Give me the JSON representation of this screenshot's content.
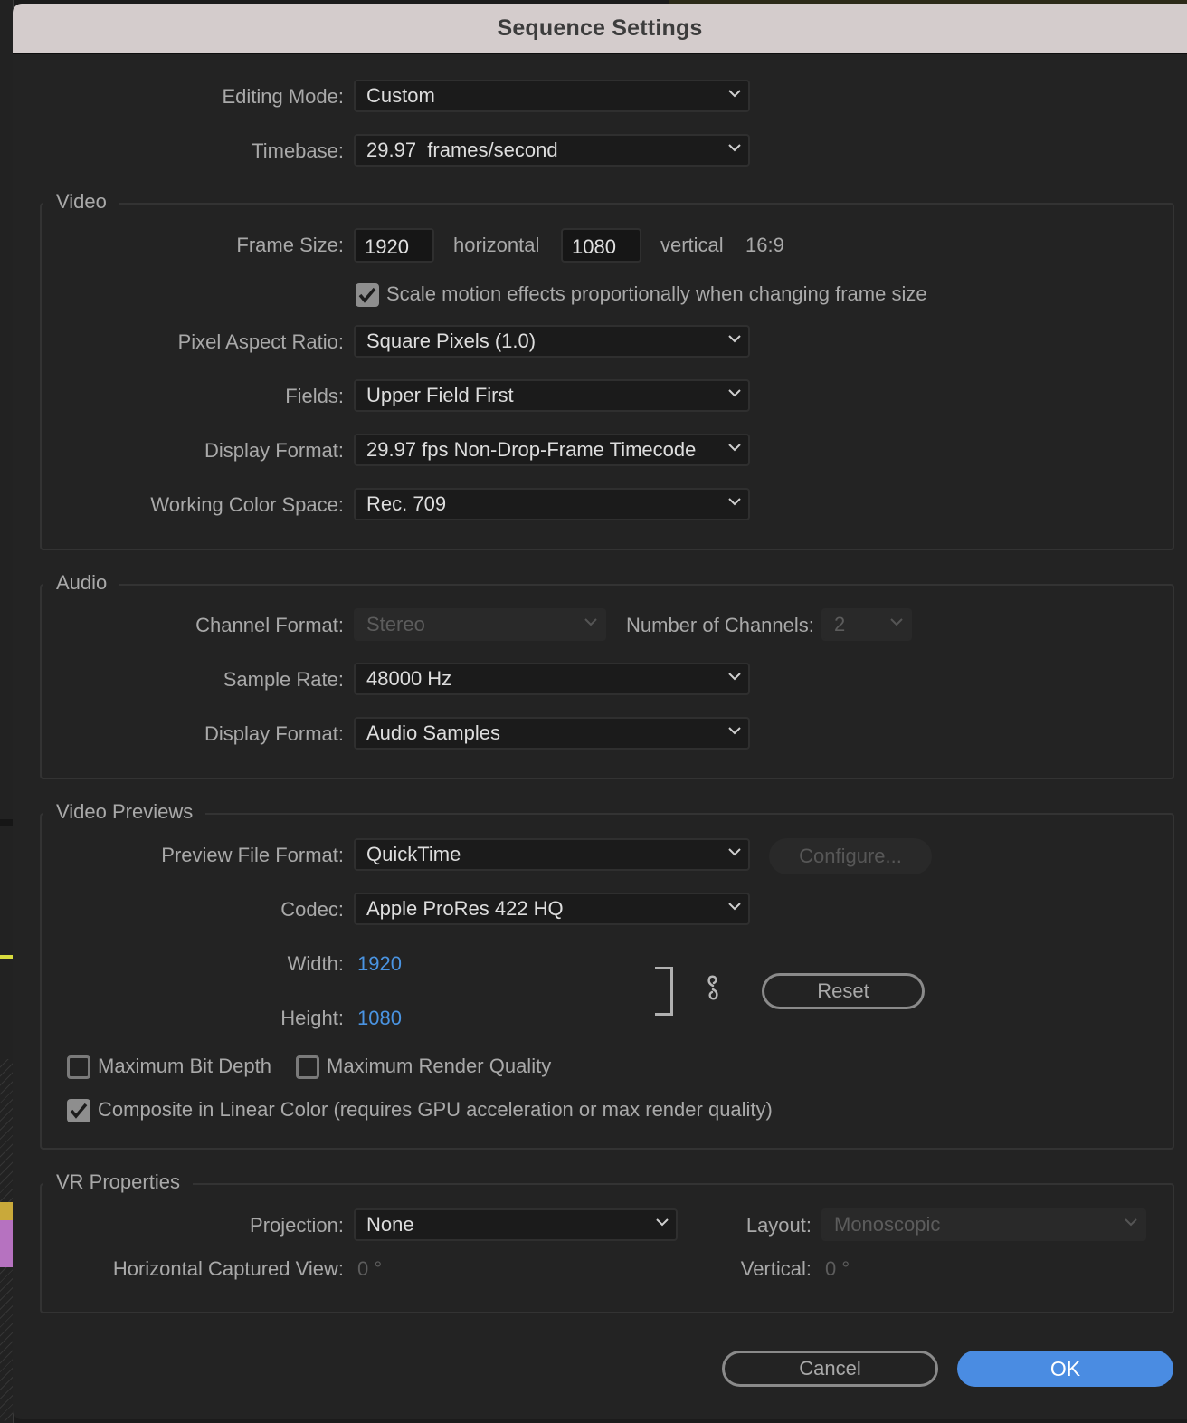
{
  "dialog": {
    "title": "Sequence Settings"
  },
  "general": {
    "editing_mode": {
      "label": "Editing Mode:",
      "value": "Custom"
    },
    "timebase": {
      "label": "Timebase:",
      "value": "29.97  frames/second"
    }
  },
  "video": {
    "title": "Video",
    "frame_size": {
      "label": "Frame Size:",
      "horizontal_value": "1920",
      "horizontal_label": "horizontal",
      "vertical_value": "1080",
      "vertical_label": "vertical",
      "aspect": "16:9"
    },
    "scale_motion": {
      "label": "Scale motion effects proportionally when changing frame size",
      "checked": true
    },
    "pixel_aspect_ratio": {
      "label": "Pixel Aspect Ratio:",
      "value": "Square Pixels (1.0)"
    },
    "fields": {
      "label": "Fields:",
      "value": "Upper Field First"
    },
    "display_format": {
      "label": "Display Format:",
      "value": "29.97 fps Non-Drop-Frame Timecode"
    },
    "working_color_space": {
      "label": "Working Color Space:",
      "value": "Rec. 709"
    }
  },
  "audio": {
    "title": "Audio",
    "channel_format": {
      "label": "Channel Format:",
      "value": "Stereo",
      "disabled": true
    },
    "number_of_channels": {
      "label": "Number of Channels:",
      "value": "2",
      "disabled": true
    },
    "sample_rate": {
      "label": "Sample Rate:",
      "value": "48000 Hz"
    },
    "display_format": {
      "label": "Display Format:",
      "value": "Audio Samples"
    }
  },
  "video_previews": {
    "title": "Video Previews",
    "preview_file_format": {
      "label": "Preview File Format:",
      "value": "QuickTime"
    },
    "configure_label": "Configure...",
    "codec": {
      "label": "Codec:",
      "value": "Apple ProRes 422 HQ"
    },
    "width": {
      "label": "Width:",
      "value": "1920"
    },
    "height": {
      "label": "Height:",
      "value": "1080"
    },
    "reset_label": "Reset",
    "link_icon": "link-icon",
    "max_bit_depth": {
      "label": "Maximum Bit Depth",
      "checked": false
    },
    "max_render_quality": {
      "label": "Maximum Render Quality",
      "checked": false
    },
    "composite_linear": {
      "label": "Composite in Linear Color (requires GPU acceleration or max render quality)",
      "checked": true
    }
  },
  "vr_properties": {
    "title": "VR Properties",
    "projection": {
      "label": "Projection:",
      "value": "None"
    },
    "layout": {
      "label": "Layout:",
      "value": "Monoscopic",
      "disabled": true
    },
    "horizontal_captured_view": {
      "label": "Horizontal Captured View:",
      "value": "0 °"
    },
    "vertical": {
      "label": "Vertical:",
      "value": "0 °"
    }
  },
  "footer": {
    "cancel_label": "Cancel",
    "ok_label": "OK"
  },
  "colors": {
    "accent": "#4a8ce2",
    "link_value": "#4a94e2",
    "titlebar": "#d4cccc",
    "dialog_bg": "#232323"
  }
}
